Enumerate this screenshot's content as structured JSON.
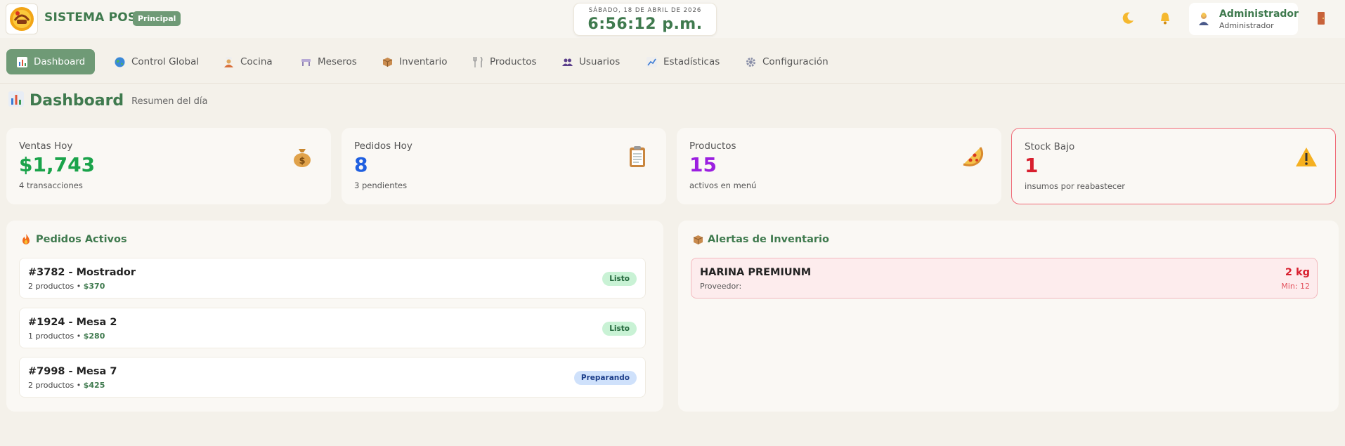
{
  "app": {
    "title": "SISTEMA POS",
    "badge": "Principal",
    "logo_icon": "restaurant-logo"
  },
  "clock": {
    "date": "SÁBADO, 18 DE ABRIL DE 2026",
    "time": "6:56:12 p.m."
  },
  "header_icons": [
    "moon-icon",
    "bell-icon",
    "exit-door-icon"
  ],
  "user": {
    "name": "Administrador",
    "role": "Administrador",
    "avatar_icon": "user-avatar-icon"
  },
  "nav": {
    "items": [
      {
        "label": "Dashboard",
        "icon": "chart-icon",
        "active": true
      },
      {
        "label": "Control Global",
        "icon": "globe-icon",
        "active": false
      },
      {
        "label": "Cocina",
        "icon": "cook-icon",
        "active": false
      },
      {
        "label": "Meseros",
        "icon": "table-icon",
        "active": false
      },
      {
        "label": "Inventario",
        "icon": "box-icon",
        "active": false
      },
      {
        "label": "Productos",
        "icon": "utensils-icon",
        "active": false
      },
      {
        "label": "Usuarios",
        "icon": "users-icon",
        "active": false
      },
      {
        "label": "Estadísticas",
        "icon": "trend-icon",
        "active": false
      },
      {
        "label": "Configuración",
        "icon": "gear-icon",
        "active": false
      }
    ]
  },
  "page": {
    "title": "Dashboard",
    "subtitle": "Resumen del día",
    "icon": "chart-icon"
  },
  "stats": [
    {
      "label": "Ventas Hoy",
      "value": "$1,743",
      "foot": "4 transacciones",
      "color": "#1aa34a",
      "icon": "money-bag-icon"
    },
    {
      "label": "Pedidos Hoy",
      "value": "8",
      "foot": "3 pendientes",
      "color": "#1f5fe0",
      "icon": "clipboard-icon"
    },
    {
      "label": "Productos",
      "value": "15",
      "foot": "activos en menú",
      "color": "#9b1fe0",
      "icon": "pizza-icon"
    },
    {
      "label": "Stock Bajo",
      "value": "1",
      "foot": "insumos por reabastecer",
      "color": "#d81f2e",
      "icon": "warning-icon"
    }
  ],
  "active_orders": {
    "title": "Pedidos Activos",
    "icon": "fire-icon",
    "items": [
      {
        "title": "#3782 - Mostrador",
        "meta": "2 productos •",
        "price": "$370",
        "status": "Listo",
        "status_kind": "ready"
      },
      {
        "title": "#1924 - Mesa 2",
        "meta": "1 productos •",
        "price": "$280",
        "status": "Listo",
        "status_kind": "ready"
      },
      {
        "title": "#7998 - Mesa 7",
        "meta": "2 productos •",
        "price": "$425",
        "status": "Preparando",
        "status_kind": "prep"
      }
    ]
  },
  "inventory_alerts": {
    "title": "Alertas de Inventario",
    "icon": "box-icon",
    "items": [
      {
        "name": "HARINA PREMIUNM",
        "supplier": "Proveedor:",
        "qty": "2 kg",
        "min": "Min: 12"
      }
    ]
  }
}
